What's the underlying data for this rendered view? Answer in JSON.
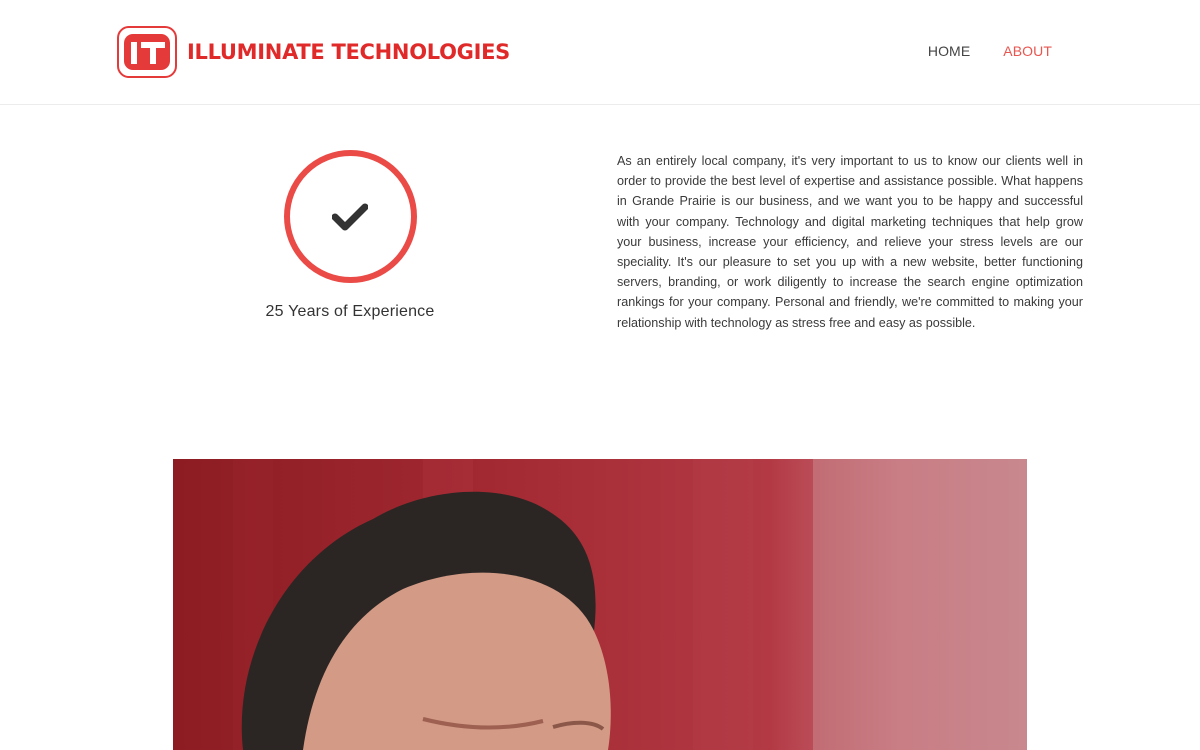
{
  "header": {
    "brand_name": "ILLUMINATE TECHNOLOGIES",
    "logo_mark_text": "IT",
    "nav": [
      {
        "label": "HOME",
        "active": false
      },
      {
        "label": "ABOUT",
        "active": true
      }
    ]
  },
  "feature": {
    "icon": "checkmark-icon",
    "caption": "25 Years of Experience"
  },
  "about": {
    "paragraph": "As an entirely local company, it's very important to us to know our clients well in order to provide the best level of expertise and assistance possible. What happens in Grande Prairie is our business, and we want you to be happy and successful with your company. Technology and digital marketing techniques that help grow your business, increase your efficiency, and relieve your stress levels are our speciality. It's our pleasure to set you up with a new website, better functioning servers, branding, or work diligently to increase the search engine optimization rankings for your company. Personal and friendly, we're committed to making your relationship with technology as stress free and easy as possible."
  },
  "colors": {
    "brand_red": "#e02a2a",
    "accent_red": "#ea4b47",
    "nav_active": "#e9564f",
    "text": "#3a3a3a"
  },
  "photo": {
    "subject": "portrait-photo"
  }
}
